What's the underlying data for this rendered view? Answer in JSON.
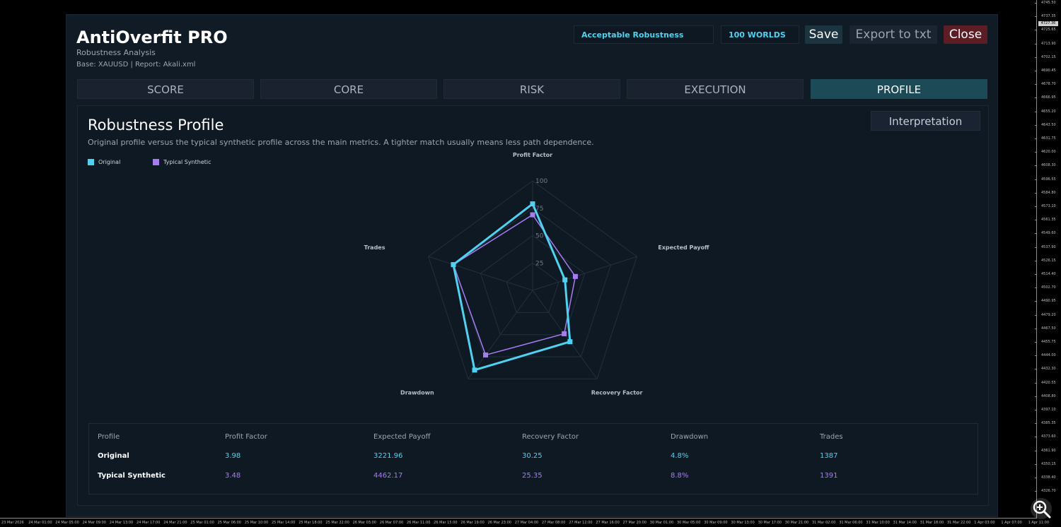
{
  "terminal": {
    "price_labels": [
      "4745.50",
      "4737.35",
      "4725.65",
      "4713.90",
      "4702.15",
      "4690.45",
      "4678.70",
      "4666.95",
      "4655.20",
      "4643.50",
      "4631.75",
      "4620.00",
      "4608.30",
      "4596.55",
      "4584.80",
      "4573.10",
      "4561.35",
      "4549.60",
      "4537.90",
      "4526.15",
      "4514.40",
      "4502.70",
      "4490.95",
      "4479.20",
      "4467.50",
      "4455.75",
      "4444.00",
      "4432.30",
      "4420.55",
      "4408.80",
      "4397.10",
      "4385.35",
      "4373.60",
      "4361.90",
      "4350.15",
      "4338.40",
      "4326.70"
    ],
    "current_price": "4727.36",
    "time_labels": [
      "23 Mar 2026",
      "24 Mar 01:00",
      "24 Mar 05:00",
      "24 Mar 09:00",
      "24 Mar 13:00",
      "24 Mar 17:00",
      "24 Mar 21:00",
      "25 Mar 01:00",
      "25 Mar 06:00",
      "25 Mar 10:00",
      "25 Mar 14:00",
      "25 Mar 18:00",
      "25 Mar 22:00",
      "26 Mar 03:00",
      "26 Mar 07:00",
      "26 Mar 11:00",
      "26 Mar 15:00",
      "26 Mar 19:00",
      "26 Mar 23:00",
      "27 Mar 04:00",
      "27 Mar 08:00",
      "27 Mar 12:00",
      "27 Mar 16:00",
      "27 Mar 20:00",
      "30 Mar 01:00",
      "30 Mar 05:00",
      "30 Mar 09:00",
      "30 Mar 13:00",
      "30 Mar 17:00",
      "30 Mar 21:00",
      "31 Mar 02:00",
      "31 Mar 06:00",
      "31 Mar 10:00",
      "31 Mar 14:00",
      "31 Mar 18:00",
      "31 Mar 22:00",
      "1 Apr 03:00",
      "1 Apr 07:00",
      "1 Apr 11:00"
    ],
    "zoom_icon": "magnifier-plus-icon"
  },
  "dialog": {
    "title": "AntiOverfit PRO",
    "subtitle": "Robustness Analysis",
    "meta": "Base: XAUUSD | Report: Akali.xml",
    "status_badge": "Acceptable Robustness",
    "worlds_badge": "100 WORLDS",
    "buttons": {
      "save": "Save",
      "export": "Export to txt",
      "close": "Close"
    },
    "tabs": [
      "SCORE",
      "CORE",
      "RISK",
      "EXECUTION",
      "PROFILE"
    ],
    "active_tab": "PROFILE"
  },
  "panel": {
    "title": "Robustness Profile",
    "description": "Original profile versus the typical synthetic profile across the main metrics. A tighter match usually means less path dependence.",
    "interpretation_button": "Interpretation"
  },
  "colors": {
    "original": "#4fd2f0",
    "synthetic": "#a77cf2",
    "grid": "#22303b",
    "accent_tab": "#1c4a57",
    "close": "#5d1d24"
  },
  "chart_data": {
    "type": "radar",
    "axes": [
      "Profit Factor",
      "Expected Payoff",
      "Recovery Factor",
      "Drawdown",
      "Trades"
    ],
    "rlim": [
      0,
      100
    ],
    "ticks": [
      25,
      50,
      75,
      100
    ],
    "legend": "top-left",
    "series": [
      {
        "name": "Original",
        "values": [
          79,
          31,
          58,
          90,
          76
        ]
      },
      {
        "name": "Typical Synthetic",
        "values": [
          69,
          41,
          49,
          73,
          76
        ]
      }
    ]
  },
  "table": {
    "headers": [
      "Profile",
      "Profit Factor",
      "Expected Payoff",
      "Recovery Factor",
      "Drawdown",
      "Trades"
    ],
    "rows": [
      {
        "label": "Original",
        "cells": [
          "3.98",
          "3221.96",
          "30.25",
          "4.8%",
          "1387"
        ]
      },
      {
        "label": "Typical Synthetic",
        "cells": [
          "3.48",
          "4462.17",
          "25.35",
          "8.8%",
          "1391"
        ]
      }
    ]
  }
}
